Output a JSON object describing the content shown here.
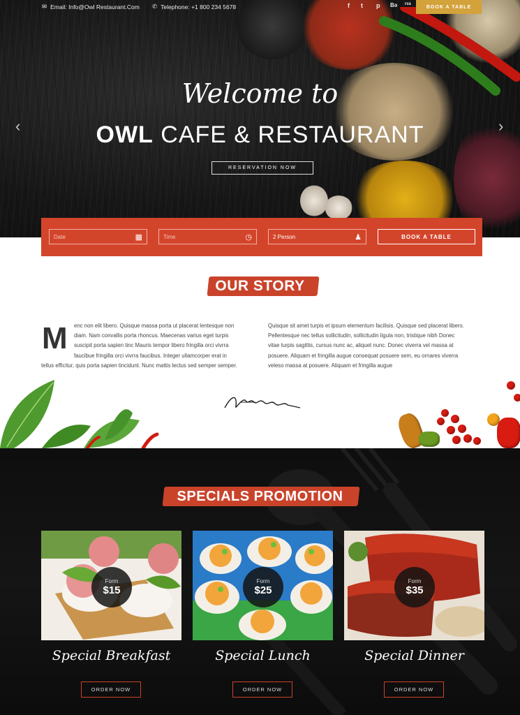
{
  "topbar": {
    "email": "Email: Info@Owl Restaurant.Com",
    "phone": "Telephone: +1 800 234 5678",
    "social": [
      "f",
      "t",
      "p",
      "Bə",
      "rss"
    ],
    "book_button": "BOOK A TABLE"
  },
  "hero": {
    "welcome": "Welcome to",
    "title_bold": "OWL",
    "title_rest": "CAFE & RESTAURANT",
    "reservation_button": "RESERVATION NOW"
  },
  "booking": {
    "date_placeholder": "Date",
    "time_placeholder": "Time",
    "persons_value": "2 Person",
    "book_button": "BOOK A TABLE"
  },
  "story": {
    "title": "OUR STORY",
    "dropcap": "M",
    "col1_lines": [
      "enc non elit libero. Quisque massa porta ut placerat lentesque non",
      "diam. Nam convallis porta rhoncus. Maecenas varius eget turpis",
      "suscipit porta sapien tinc Mauris tempor libero fringilla orci vivrra",
      "faucibue fringilla orci vivrra faucibus. Integer ullamcorper erat in",
      "tellus efficitur, quis porta sapien tincidunt. Nunc mattis lectus sed semper semper."
    ],
    "col2_lines": [
      "Quisque sit amet turpis et ipsum elementum facilisis. Quisque sed placerat libero.",
      "Pellentesque nec tellus sollicitudin, sollicitudin ligula non, tristique nibh Donec",
      "vitae turpis sagittis, cursus nunc ac, aliquet nunc. Donec viverra vel massa at",
      "posuere. Aliquam et fringilla augue consequat posuere sem, eu ornares viverra",
      "veleso massa at posuere. Aliquam et fringilla augue"
    ]
  },
  "specials": {
    "title": "SPECIALS PROMOTION",
    "items": [
      {
        "price_label": "Form",
        "price": "$15",
        "name": "Special Breakfast",
        "button": "ORDER NOW"
      },
      {
        "price_label": "Form",
        "price": "$25",
        "name": "Special Lunch",
        "button": "ORDER NOW"
      },
      {
        "price_label": "Form",
        "price": "$35",
        "name": "Special Dinner",
        "button": "ORDER NOW"
      }
    ]
  },
  "colors": {
    "accent_red": "#d3452b",
    "gold": "#d3a23b",
    "dark": "#111111"
  }
}
